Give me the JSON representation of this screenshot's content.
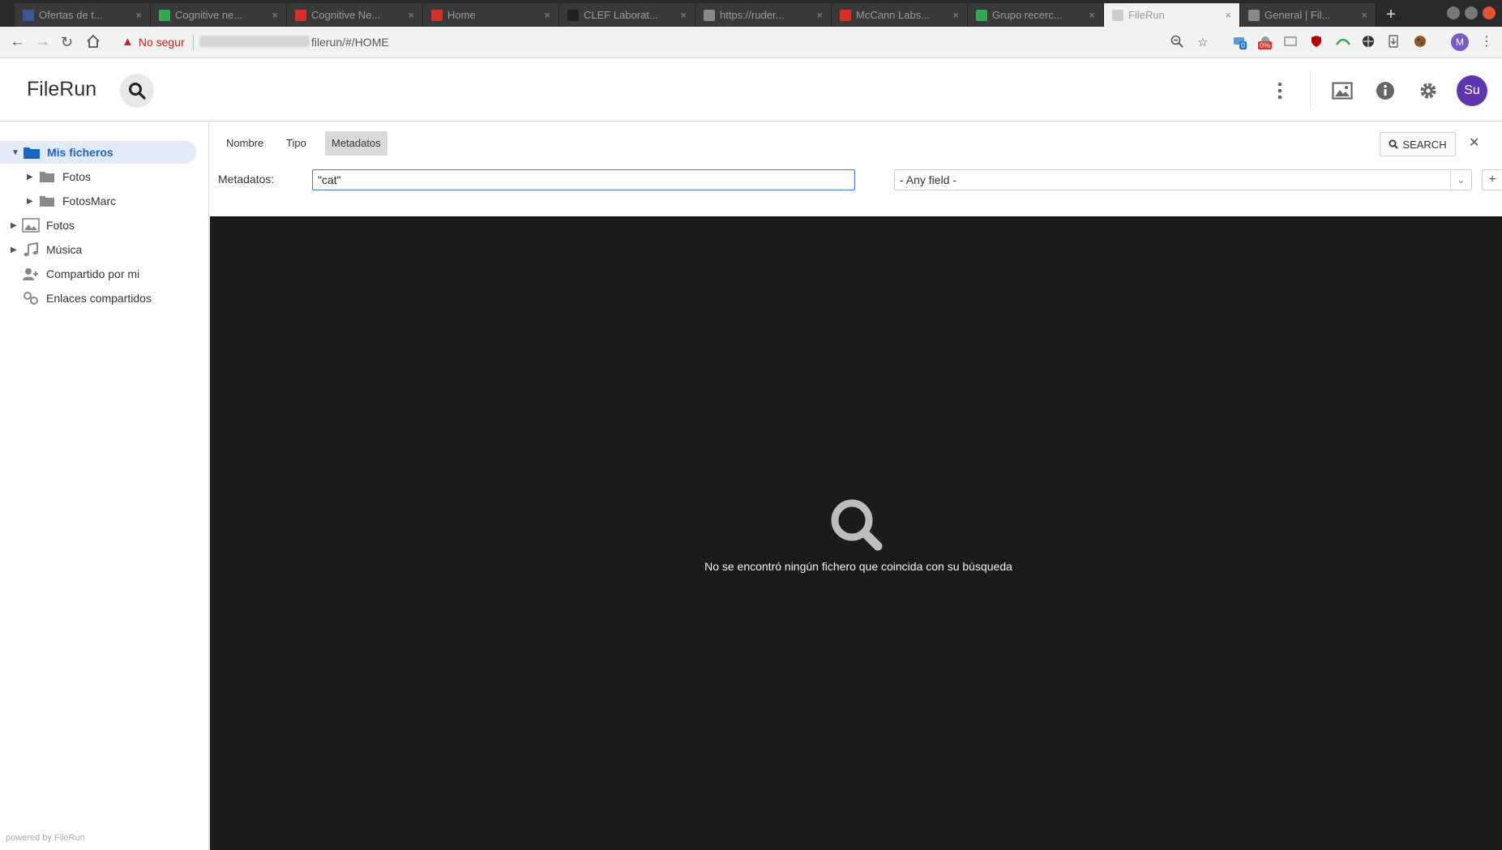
{
  "browser": {
    "tabs": [
      {
        "label": "Ofertas de t...",
        "color": "#3b5998"
      },
      {
        "label": "Cognitive ne...",
        "color": "#34a853"
      },
      {
        "label": "Cognitive Ne...",
        "color": "#d93025"
      },
      {
        "label": "Home",
        "color": "#d93025"
      },
      {
        "label": "CLEF Laborat...",
        "color": "#222222"
      },
      {
        "label": "https://ruder...",
        "color": "#888888"
      },
      {
        "label": "McCann Labs...",
        "color": "#d93025"
      },
      {
        "label": "Grupo recerc...",
        "color": "#34a853"
      },
      {
        "label": "FileRun",
        "color": "#cccccc",
        "active": true
      },
      {
        "label": "General | Fil...",
        "color": "#888888"
      }
    ],
    "security_label": "No segur",
    "url_visible": "filerun/#/HOME",
    "ext_badge_1": "0",
    "ext_badge_2": "0%",
    "profile_initial": "M"
  },
  "app": {
    "brand": "FileRun",
    "avatar_initials": "Su"
  },
  "sidebar": {
    "items": [
      {
        "label": "Mis ficheros",
        "selected": true,
        "icon": "folder-icon"
      },
      {
        "label": "Fotos",
        "icon": "folder-icon"
      },
      {
        "label": "FotosMarc",
        "icon": "folder-icon"
      },
      {
        "label": "Fotos",
        "icon": "image-icon"
      },
      {
        "label": "Música",
        "icon": "music-icon"
      },
      {
        "label": "Compartido por mi",
        "icon": "share-user-icon"
      },
      {
        "label": "Enlaces compartidos",
        "icon": "link-icon"
      }
    ],
    "powered_by": "powered by FileRun"
  },
  "search": {
    "tabs": [
      {
        "label": "Nombre"
      },
      {
        "label": "Tipo"
      },
      {
        "label": "Metadatos",
        "active": true
      }
    ],
    "search_button": "SEARCH",
    "metadata_label": "Metadatos:",
    "metadata_value": "\"cat\"",
    "field_select": "- Any field -"
  },
  "results": {
    "empty_message": "No se encontró ningún fichero que coincida con su búsqueda"
  }
}
